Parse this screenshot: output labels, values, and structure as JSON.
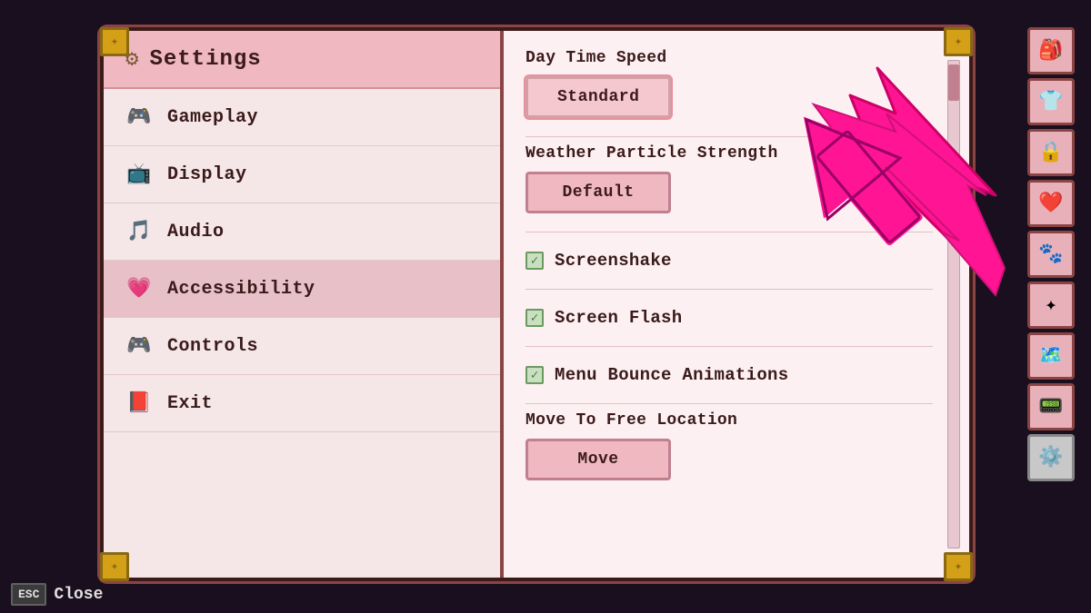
{
  "title": "Settings",
  "sidebar": {
    "title": "Settings",
    "items": [
      {
        "id": "gameplay",
        "label": "Gameplay",
        "icon": "🎮"
      },
      {
        "id": "display",
        "label": "Display",
        "icon": "📺"
      },
      {
        "id": "audio",
        "label": "Audio",
        "icon": "🎵"
      },
      {
        "id": "accessibility",
        "label": "Accessibility",
        "icon": "💗",
        "active": true
      },
      {
        "id": "controls",
        "label": "Controls",
        "icon": "🎮"
      },
      {
        "id": "exit",
        "label": "Exit",
        "icon": "📕"
      }
    ]
  },
  "content": {
    "settings": [
      {
        "id": "day-time-speed",
        "type": "button-option",
        "label": "Day Time Speed",
        "value": "Standard"
      },
      {
        "id": "weather-particle-strength",
        "type": "button-option",
        "label": "Weather Particle Strength",
        "value": "Default"
      },
      {
        "id": "screenshake",
        "type": "checkbox",
        "label": "Screenshake",
        "checked": true
      },
      {
        "id": "screen-flash",
        "type": "checkbox",
        "label": "Screen Flash",
        "checked": true
      },
      {
        "id": "menu-bounce-animations",
        "type": "checkbox",
        "label": "Menu Bounce Animations",
        "checked": true
      },
      {
        "id": "move-to-free-location",
        "type": "button-option",
        "label": "Move To Free Location",
        "value": "Move"
      }
    ]
  },
  "rightIcons": [
    "🎒",
    "👕",
    "🔒",
    "❤️",
    "🐾",
    "✦",
    "🗺️",
    "📟",
    "⚙️"
  ],
  "footer": {
    "escKey": "ESC",
    "closeLabel": "Close"
  }
}
